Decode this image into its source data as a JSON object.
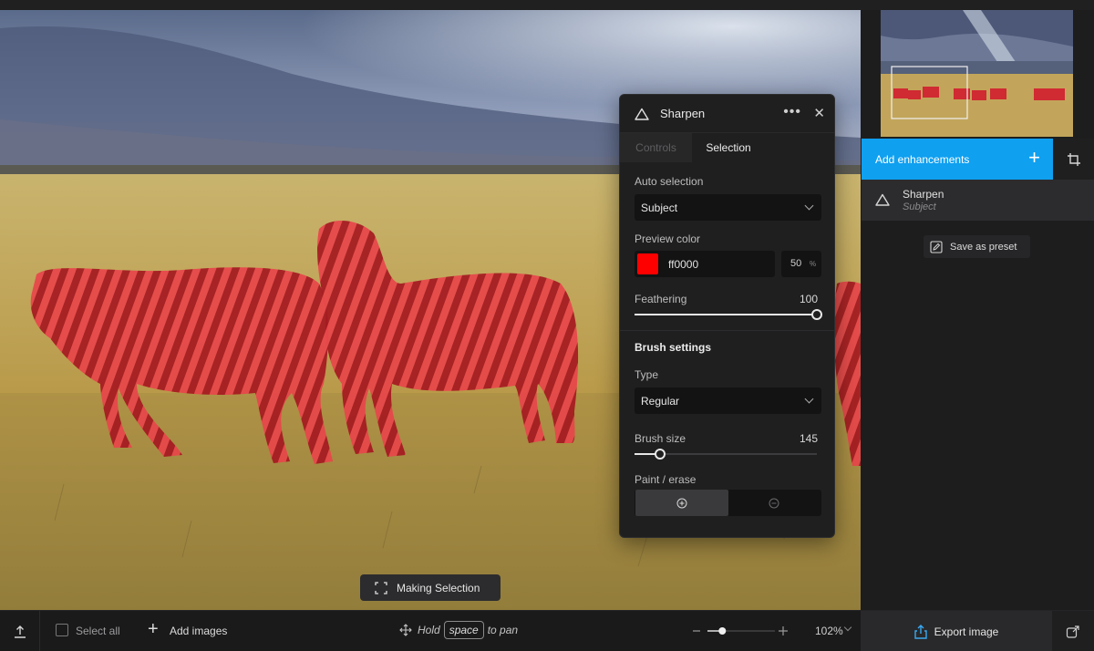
{
  "panel": {
    "title": "Sharpen",
    "more_glyph": "•••",
    "close_glyph": "✕",
    "tabs": [
      {
        "label": "Controls"
      },
      {
        "label": "Selection"
      }
    ],
    "auto_selection": {
      "label": "Auto selection",
      "value": "Subject"
    },
    "preview_color": {
      "label": "Preview color",
      "hex": "ff0000",
      "opacity": "50",
      "opacity_unit": "%",
      "swatch_color": "#ff0000"
    },
    "feathering": {
      "label": "Feathering",
      "value": "100",
      "level": 1.0
    },
    "brush_settings": {
      "title": "Brush settings",
      "type": {
        "label": "Type",
        "value": "Regular"
      },
      "brush_size": {
        "label": "Brush size",
        "value": "145",
        "level": 0.14
      },
      "paint_erase": {
        "label": "Paint / erase"
      }
    }
  },
  "toast": {
    "label": "Making Selection"
  },
  "sidebar": {
    "add_enhancements": "Add enhancements",
    "add_glyph": "+",
    "accent_color": "#0fa0f0",
    "layer": {
      "name": "Sharpen",
      "sub": "Subject"
    },
    "save_preset": "Save as preset"
  },
  "bottombar": {
    "select_all": "Select all",
    "add_glyph": "+",
    "add_images": "Add images",
    "hold": "Hold",
    "key": "space",
    "to_pan": "to pan",
    "zoom": "102%",
    "zoom_level": 0.22,
    "export": "Export image"
  },
  "icons": {
    "enhancement": "triangle-icon",
    "crop": "crop-icon",
    "preset": "edit-preset-icon",
    "upload": "upload-icon",
    "move": "move-icon",
    "export": "export-icon",
    "share": "share-icon",
    "selection": "selection-frame-icon"
  }
}
